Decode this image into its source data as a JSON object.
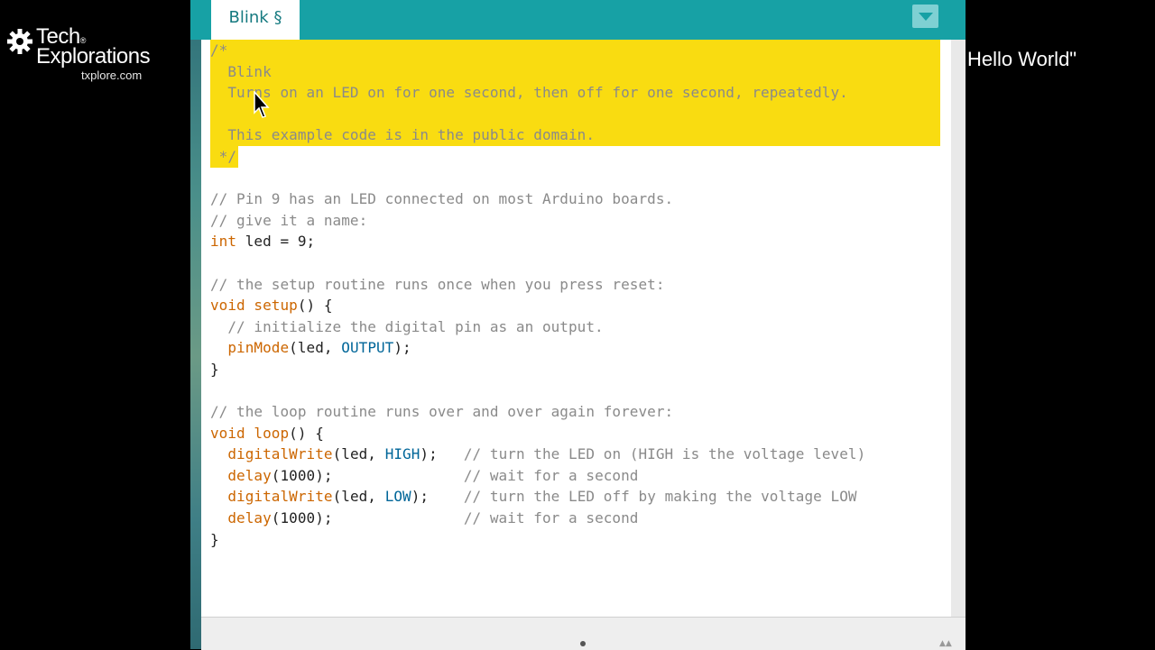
{
  "logo": {
    "line1": "Tech",
    "reg": "®",
    "line2": "Explorations",
    "url": "txplore.com"
  },
  "side_title": "Hello World\"",
  "ide": {
    "tab_label": "Blink §",
    "colors": {
      "tabbar": "#17a1a5",
      "highlight": "#f9dc11",
      "comment": "#8a8a8a",
      "keyword": "#cc6600",
      "constant": "#006699"
    },
    "code_lines": [
      [
        {
          "t": "/*",
          "c": "c"
        }
      ],
      [
        {
          "t": "  Blink",
          "c": "c"
        }
      ],
      [
        {
          "t": "  Turns on an LED on for one second, then off for one second, repeatedly.",
          "c": "c"
        }
      ],
      [],
      [
        {
          "t": "  This example code is in the public domain.",
          "c": "c"
        }
      ],
      [
        {
          "t": " */",
          "c": "c"
        }
      ],
      [],
      [
        {
          "t": "// Pin 9 has an LED connected on most Arduino boards.",
          "c": "c"
        }
      ],
      [
        {
          "t": "// give it a name:",
          "c": "c"
        }
      ],
      [
        {
          "t": "int",
          "c": "k"
        },
        {
          "t": " led = 9;",
          "c": ""
        }
      ],
      [],
      [
        {
          "t": "// the setup routine runs once when you press reset:",
          "c": "c"
        }
      ],
      [
        {
          "t": "void",
          "c": "k"
        },
        {
          "t": " ",
          "c": ""
        },
        {
          "t": "setup",
          "c": "k"
        },
        {
          "t": "() {",
          "c": ""
        }
      ],
      [
        {
          "t": "  // initialize the digital pin as an output.",
          "c": "c"
        }
      ],
      [
        {
          "t": "  ",
          "c": ""
        },
        {
          "t": "pinMode",
          "c": "k"
        },
        {
          "t": "(led, ",
          "c": ""
        },
        {
          "t": "OUTPUT",
          "c": "b"
        },
        {
          "t": ");",
          "c": ""
        }
      ],
      [
        {
          "t": "}",
          "c": ""
        }
      ],
      [],
      [
        {
          "t": "// the loop routine runs over and over again forever:",
          "c": "c"
        }
      ],
      [
        {
          "t": "void",
          "c": "k"
        },
        {
          "t": " ",
          "c": ""
        },
        {
          "t": "loop",
          "c": "k"
        },
        {
          "t": "() {",
          "c": ""
        }
      ],
      [
        {
          "t": "  ",
          "c": ""
        },
        {
          "t": "digitalWrite",
          "c": "k"
        },
        {
          "t": "(led, ",
          "c": ""
        },
        {
          "t": "HIGH",
          "c": "b"
        },
        {
          "t": ");   ",
          "c": ""
        },
        {
          "t": "// turn the LED on (HIGH is the voltage level)",
          "c": "c"
        }
      ],
      [
        {
          "t": "  ",
          "c": ""
        },
        {
          "t": "delay",
          "c": "k"
        },
        {
          "t": "(1000);               ",
          "c": ""
        },
        {
          "t": "// wait for a second",
          "c": "c"
        }
      ],
      [
        {
          "t": "  ",
          "c": ""
        },
        {
          "t": "digitalWrite",
          "c": "k"
        },
        {
          "t": "(led, ",
          "c": ""
        },
        {
          "t": "LOW",
          "c": "b"
        },
        {
          "t": ");    ",
          "c": ""
        },
        {
          "t": "// turn the LED off by making the voltage LOW",
          "c": "c"
        }
      ],
      [
        {
          "t": "  ",
          "c": ""
        },
        {
          "t": "delay",
          "c": "k"
        },
        {
          "t": "(1000);               ",
          "c": ""
        },
        {
          "t": "// wait for a second",
          "c": "c"
        }
      ],
      [
        {
          "t": "}",
          "c": ""
        }
      ]
    ]
  }
}
